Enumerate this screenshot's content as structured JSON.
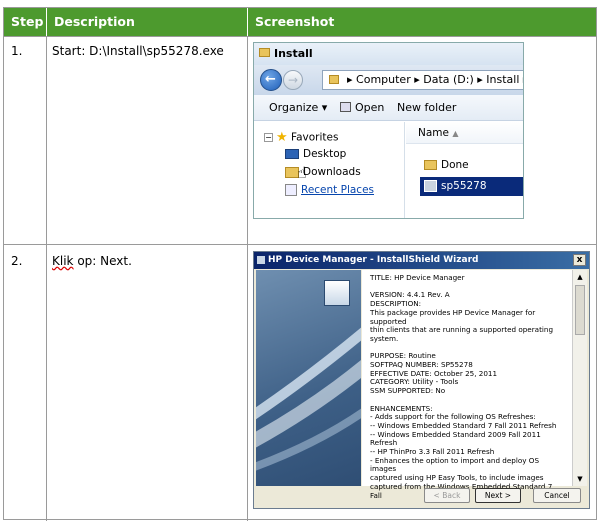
{
  "headers": {
    "step": "Step",
    "description": "Description",
    "screenshot": "Screenshot"
  },
  "colors": {
    "header_bg": "#4d9a2e",
    "header_text": "#ffffff"
  },
  "rows": [
    {
      "step": "1.",
      "description": "Start: D:\\Install\\sp55278.exe"
    },
    {
      "step": "2.",
      "description_prefix": "Klik",
      "description_rest": " op: Next."
    }
  ],
  "explorer": {
    "title": "Install",
    "breadcrumb": [
      "Computer",
      "Data (D:)",
      "Install"
    ],
    "toolbar": {
      "organize": "Organize",
      "open": "Open",
      "new_folder": "New folder"
    },
    "nav": {
      "favorites": "Favorites",
      "desktop": "Desktop",
      "downloads": "Downloads",
      "recent": "Recent Places"
    },
    "column_name": "Name",
    "files": [
      {
        "name": "Done",
        "type": "folder"
      },
      {
        "name": "sp55278",
        "type": "installer",
        "selected": true
      }
    ]
  },
  "installer": {
    "title": "HP Device Manager - InstallShield Wizard",
    "close": "x",
    "lines": [
      "TITLE: HP Device Manager",
      "",
      "VERSION: 4.4.1 Rev. A",
      "DESCRIPTION:",
      "This package provides HP Device Manager for supported",
      "thin clients that are running a supported operating",
      "system.",
      "",
      "PURPOSE: Routine",
      "SOFTPAQ NUMBER: SP55278",
      "EFFECTIVE DATE: October 25, 2011",
      "CATEGORY: Utility - Tools",
      "SSM SUPPORTED: No",
      "",
      "ENHANCEMENTS:",
      "- Adds support for the following OS Refreshes:",
      "-- Windows Embedded Standard 7 Fall 2011 Refresh",
      "-- Windows Embedded Standard 2009 Fall 2011 Refresh",
      "-- HP ThinPro 3.3 Fall 2011 Refresh",
      "- Enhances the option to import and deploy OS images",
      "captured using HP Easy Tools, to include images",
      "captured from the Windows Embedded Standard 7 Fall"
    ],
    "buttons": {
      "back": "< Back",
      "next": "Next >",
      "cancel": "Cancel"
    }
  }
}
